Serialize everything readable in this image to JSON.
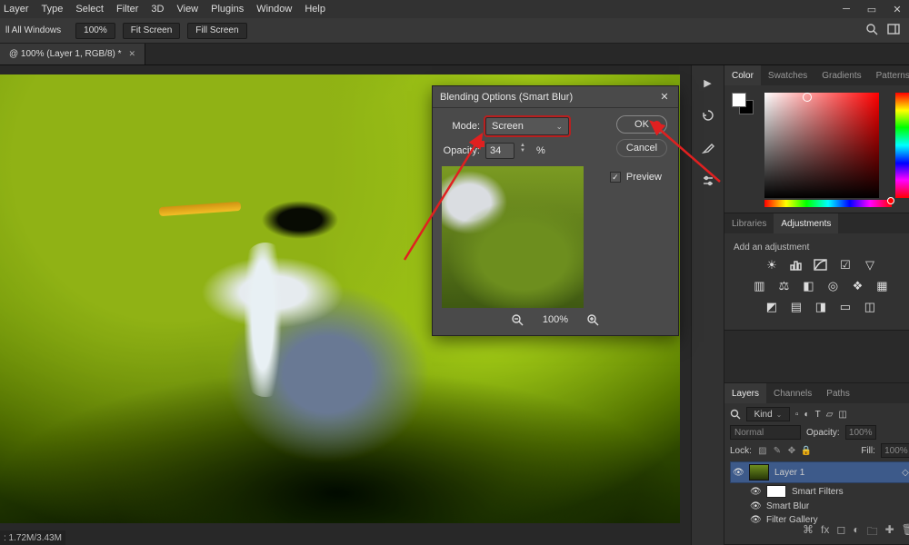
{
  "menu": {
    "items": [
      "Layer",
      "Type",
      "Select",
      "Filter",
      "3D",
      "View",
      "Plugins",
      "Window",
      "Help"
    ]
  },
  "optionsbar": {
    "all_windows": "ll All Windows",
    "zoom_value": "100%",
    "fit_screen": "Fit Screen",
    "fill_screen": "Fill Screen"
  },
  "doc_tab": {
    "label": "@ 100% (Layer 1, RGB/8) *"
  },
  "statusbar": {
    "doc_size": ":  1.72M/3.43M"
  },
  "right": {
    "color_tabs": [
      "Color",
      "Swatches",
      "Gradients",
      "Patterns"
    ],
    "libs_tabs": [
      "Libraries",
      "Adjustments"
    ],
    "adjustments": {
      "heading": "Add an adjustment",
      "row1": [
        "brightness",
        "levels",
        "curves",
        "exposure",
        "vibrance"
      ],
      "row2": [
        "hue",
        "color-balance",
        "bw",
        "photo-filter",
        "channel-mixer",
        "lookup"
      ],
      "row3": [
        "invert",
        "posterize",
        "threshold",
        "gradient-map",
        "selective"
      ]
    },
    "layers_tabs": [
      "Layers",
      "Channels",
      "Paths"
    ],
    "layers": {
      "kind": "Kind",
      "blend_mode": "Normal",
      "opacity_label": "Opacity:",
      "opacity": "100%",
      "lock_label": "Lock:",
      "fill_label": "Fill:",
      "fill": "100%",
      "layer1": "Layer 1",
      "smart_filters": "Smart Filters",
      "smart_blur": "Smart Blur",
      "filter_gallery": "Filter Gallery"
    }
  },
  "dialog": {
    "title": "Blending Options (Smart Blur)",
    "mode_label": "Mode:",
    "mode_value": "Screen",
    "opacity_label": "Opacity:",
    "opacity_value": "34",
    "percent": "%",
    "ok": "OK",
    "cancel": "Cancel",
    "preview_label": "Preview",
    "zoom": "100%"
  }
}
